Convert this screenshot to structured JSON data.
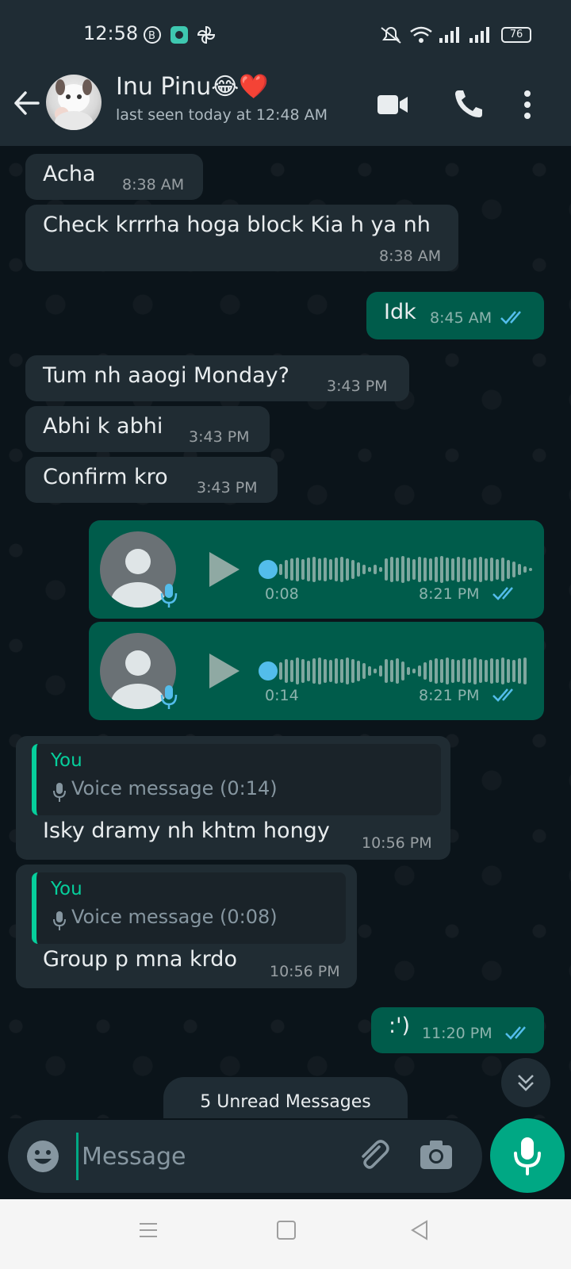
{
  "status_bar": {
    "time": "12:58",
    "battery": "76"
  },
  "contact": {
    "name": "Inu Pinu😂❤️",
    "last_seen": "last seen today at 12:48 AM"
  },
  "messages": [
    {
      "direction": "in",
      "text": "Acha",
      "time": "8:38 AM"
    },
    {
      "direction": "in",
      "text": "Check krrrha hoga block Kia h ya nh",
      "time": "8:38 AM"
    },
    {
      "direction": "out",
      "text": "Idk",
      "time": "8:45 AM",
      "status": "read"
    },
    {
      "direction": "in",
      "text": "Tum nh aaogi Monday?",
      "time": "3:43 PM"
    },
    {
      "direction": "in",
      "text": "Abhi k abhi",
      "time": "3:43 PM"
    },
    {
      "direction": "in",
      "text": "Confirm kro",
      "time": "3:43 PM"
    },
    {
      "direction": "out",
      "type": "voice",
      "duration": "0:08",
      "time": "8:21 PM",
      "status": "read"
    },
    {
      "direction": "out",
      "type": "voice",
      "duration": "0:14",
      "time": "8:21 PM",
      "status": "read"
    },
    {
      "direction": "in",
      "quote_author": "You",
      "quote_text": "Voice message (0:14)",
      "text": "Isky dramy nh khtm hongy",
      "time": "10:56 PM"
    },
    {
      "direction": "in",
      "quote_author": "You",
      "quote_text": "Voice message (0:08)",
      "text": "Group p mna krdo",
      "time": "10:56 PM"
    },
    {
      "direction": "out",
      "text": ":')",
      "time": "11:20 PM",
      "status": "read"
    }
  ],
  "unread_banner": "5 Unread Messages",
  "composer": {
    "placeholder": "Message"
  },
  "colors": {
    "incoming": "#202c33",
    "outgoing": "#005c4b",
    "accent": "#00a884",
    "read_tick": "#53bdeb"
  },
  "icons": [
    "back-arrow-icon",
    "video-call-icon",
    "voice-call-icon",
    "more-options-icon",
    "emoji-icon",
    "attach-icon",
    "camera-icon",
    "mic-icon",
    "scroll-down-icon"
  ]
}
